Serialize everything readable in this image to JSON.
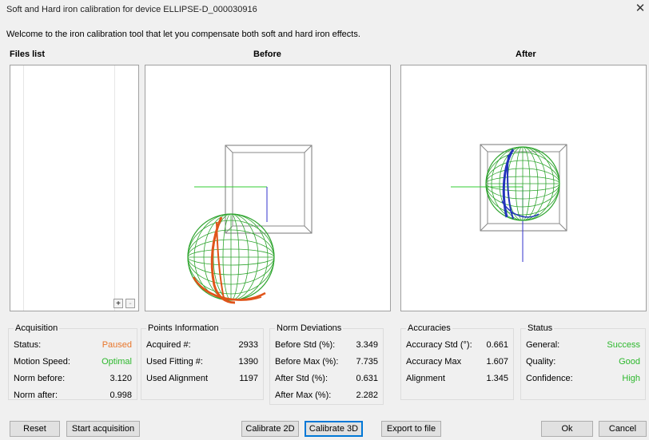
{
  "window": {
    "title": "Soft and Hard iron calibration for device ELLIPSE-D_000030916",
    "close_glyph": "✕"
  },
  "welcome_text": "Welcome to the iron calibration tool that let you compensate both soft and hard iron effects.",
  "headers": {
    "files_list": "Files list",
    "before": "Before",
    "after": "After"
  },
  "files_list": {
    "add_glyph": "+",
    "remove_glyph": "-"
  },
  "acquisition": {
    "title": "Acquisition",
    "status_label": "Status:",
    "status_value": "Paused",
    "speed_label": "Motion Speed:",
    "speed_value": "Optimal",
    "norm_before_label": "Norm before:",
    "norm_before_value": "3.120",
    "norm_after_label": "Norm after:",
    "norm_after_value": "0.998"
  },
  "points": {
    "title": "Points Information",
    "acquired_label": "Acquired #:",
    "acquired_value": "2933",
    "fitting_label": "Used Fitting #:",
    "fitting_value": "1390",
    "alignment_label": "Used Alignment",
    "alignment_value": "1197"
  },
  "norm_dev": {
    "title": "Norm Deviations",
    "before_std_label": "Before Std (%):",
    "before_std_value": "3.349",
    "before_max_label": "Before Max (%):",
    "before_max_value": "7.735",
    "after_std_label": "After Std (%):",
    "after_std_value": "0.631",
    "after_max_label": "After Max (%):",
    "after_max_value": "2.282"
  },
  "accuracies": {
    "title": "Accuracies",
    "std_label": "Accuracy Std (°):",
    "std_value": "0.661",
    "max_label": "Accuracy Max",
    "max_value": "1.607",
    "alignment_label": "Alignment",
    "alignment_value": "1.345"
  },
  "status": {
    "title": "Status",
    "general_label": "General:",
    "general_value": "Success",
    "quality_label": "Quality:",
    "quality_value": "Good",
    "confidence_label": "Confidence:",
    "confidence_value": "High"
  },
  "buttons": {
    "reset": "Reset",
    "start": "Start acquisition",
    "calibrate_2d": "Calibrate 2D",
    "calibrate_3d": "Calibrate 3D",
    "export": "Export to file",
    "ok": "Ok",
    "cancel": "Cancel"
  },
  "colors": {
    "paused": "#e8762b",
    "good": "#2db82d",
    "before_sphere": "#e0541a",
    "grid_green": "#2fa52f",
    "after_trace": "#2233bb"
  }
}
